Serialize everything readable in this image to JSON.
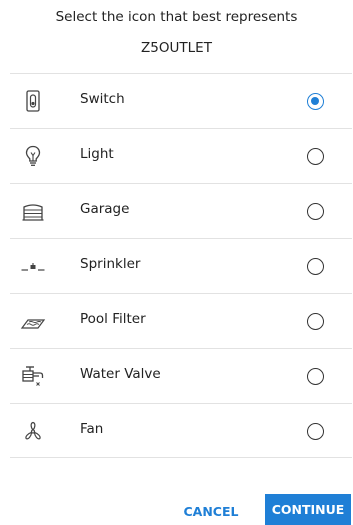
{
  "header": {
    "title": "Select the icon that best represents",
    "device_name": "Z5OUTLET"
  },
  "options": [
    {
      "label": "Switch",
      "icon": "switch-icon",
      "selected": true
    },
    {
      "label": "Light",
      "icon": "light-bulb-icon",
      "selected": false
    },
    {
      "label": "Garage",
      "icon": "garage-icon",
      "selected": false
    },
    {
      "label": "Sprinkler",
      "icon": "sprinkler-icon",
      "selected": false
    },
    {
      "label": "Pool Filter",
      "icon": "pool-filter-icon",
      "selected": false
    },
    {
      "label": "Water Valve",
      "icon": "water-valve-icon",
      "selected": false
    },
    {
      "label": "Fan",
      "icon": "fan-icon",
      "selected": false
    }
  ],
  "buttons": {
    "cancel_label": "CANCEL",
    "continue_label": "CONTINUE"
  },
  "colors": {
    "accent": "#1f7fd6",
    "text": "#222222",
    "divider": "#e2e2e2"
  }
}
